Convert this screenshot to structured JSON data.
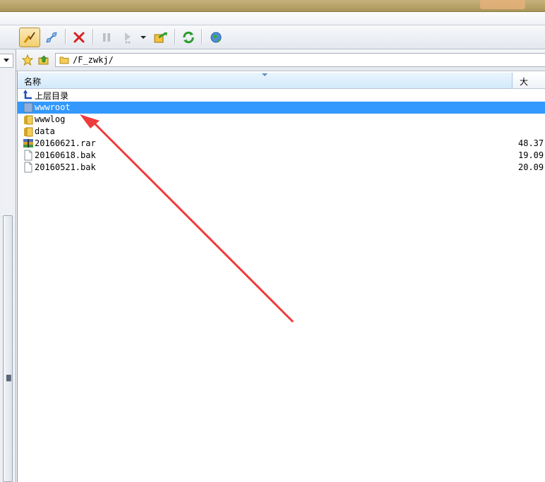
{
  "address": {
    "path": "/F_zwkj/"
  },
  "columns": {
    "name": "名称",
    "size": "大"
  },
  "files": [
    {
      "name": "上层目录",
      "size": "",
      "icon": "parent-dir-icon",
      "selected": false
    },
    {
      "name": "wwwroot",
      "size": "",
      "icon": "folder-icon",
      "selected": true
    },
    {
      "name": "wwwlog",
      "size": "",
      "icon": "folder-icon",
      "selected": false
    },
    {
      "name": "data",
      "size": "",
      "icon": "folder-icon",
      "selected": false
    },
    {
      "name": "20160621.rar",
      "size": "48.37",
      "icon": "rar-archive-icon",
      "selected": false
    },
    {
      "name": "20160618.bak",
      "size": "19.09",
      "icon": "file-icon",
      "selected": false
    },
    {
      "name": "20160521.bak",
      "size": "20.09",
      "icon": "file-icon",
      "selected": false
    }
  ],
  "toolbar_icons": [
    "connect-icon",
    "quick-connect-icon",
    "disconnect-icon",
    "pause-icon",
    "play-icon",
    "dropdown-arrow-icon",
    "transfer-icon",
    "refresh-icon",
    "web-globe-icon"
  ],
  "colors": {
    "selection": "#3399ff",
    "arrow": "#ee3b3b",
    "title": "#b7a468"
  }
}
